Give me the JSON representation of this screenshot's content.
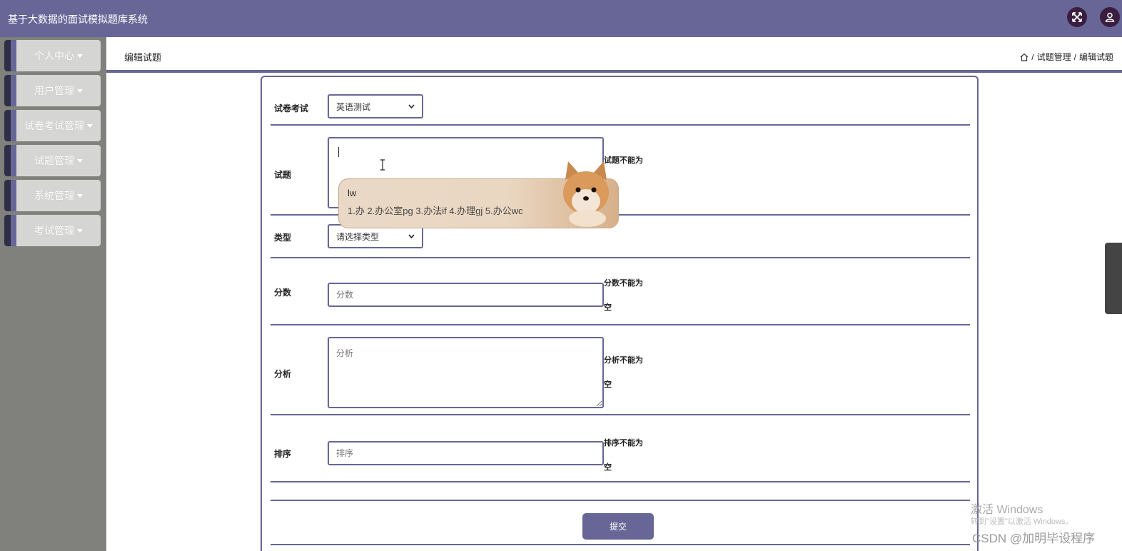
{
  "app": {
    "title": "基于大数据的面试模拟题库系统"
  },
  "header": {
    "fullscreen_icon": "expand-icon",
    "user_icon": "user-icon"
  },
  "sidebar": {
    "items": [
      {
        "label": "个人中心"
      },
      {
        "label": "用户管理"
      },
      {
        "label": "试卷考试管理"
      },
      {
        "label": "试题管理"
      },
      {
        "label": "系统管理"
      },
      {
        "label": "考试管理"
      }
    ]
  },
  "page": {
    "title": "编辑试题",
    "breadcrumb": {
      "home_icon": "home-icon",
      "sep": "/",
      "parent": "试题管理",
      "current": "编辑试题"
    }
  },
  "form": {
    "exam": {
      "label": "试卷考试",
      "value": "英语测试"
    },
    "question": {
      "label": "试题",
      "value": "",
      "error": "试题不能为"
    },
    "type": {
      "label": "类型",
      "value": "请选择类型"
    },
    "score": {
      "label": "分数",
      "placeholder": "分数",
      "error": "分数不能为",
      "error2": "空"
    },
    "analysis": {
      "label": "分析",
      "placeholder": "分析",
      "error": "分析不能为",
      "error2": "空"
    },
    "order": {
      "label": "排序",
      "placeholder": "排序",
      "error": "排序不能为",
      "error2": "空"
    },
    "submit_label": "提交"
  },
  "ime": {
    "composition": "lw",
    "candidates": "1.办  2.办公室pg  3.办法if  4.办理gj  5.办公wc"
  },
  "watermark": {
    "line1": "激活 Windows",
    "line2": "转到\"设置\"以激活 Windows。",
    "line3": "CSDN @加明毕设程序"
  }
}
